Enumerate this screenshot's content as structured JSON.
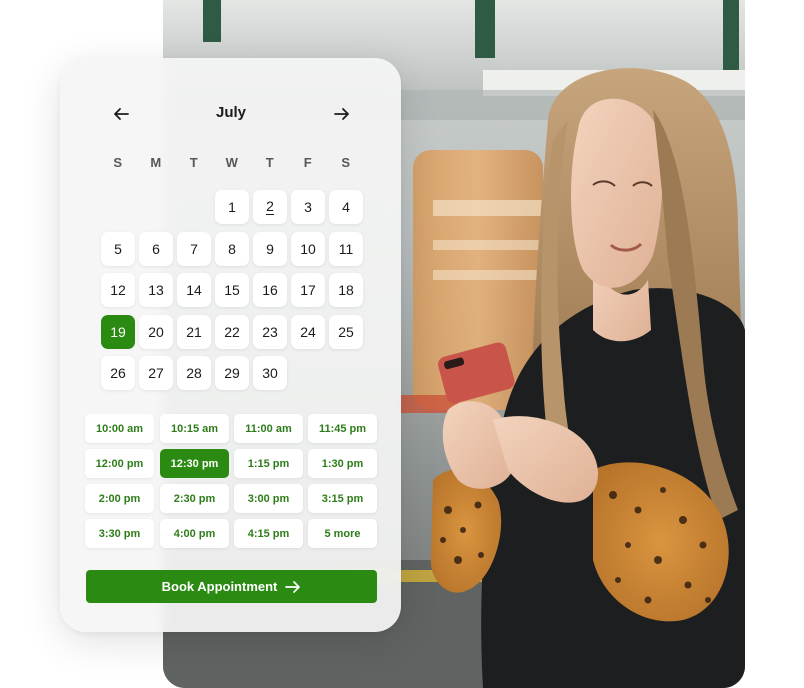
{
  "calendar": {
    "month": "July",
    "weekdays": [
      "S",
      "M",
      "T",
      "W",
      "T",
      "F",
      "S"
    ],
    "days": [
      "1",
      "2",
      "3",
      "4",
      "5",
      "6",
      "7",
      "8",
      "9",
      "10",
      "11",
      "12",
      "13",
      "14",
      "15",
      "16",
      "17",
      "18",
      "19",
      "20",
      "21",
      "22",
      "23",
      "24",
      "25",
      "26",
      "27",
      "28",
      "29",
      "30"
    ],
    "selected_day": "19",
    "underlined_day": "2"
  },
  "time_slots": [
    "10:00 am",
    "10:15 am",
    "11:00 am",
    "11:45 pm",
    "12:00 pm",
    "12:30 pm",
    "1:15 pm",
    "1:30 pm",
    "2:00 pm",
    "2:30 pm",
    "3:00 pm",
    "3:15 pm",
    "3:30 pm",
    "4:00 pm",
    "4:15 pm",
    "5 more"
  ],
  "selected_slot": "12:30 pm",
  "book_button": {
    "label": "Book Appointment"
  },
  "icons": {
    "prev": "arrow-left-icon",
    "next": "arrow-right-icon",
    "button": "arrow-right-icon"
  },
  "colors": {
    "accent": "#2a8a12",
    "slot_text": "#2e7d1a"
  }
}
